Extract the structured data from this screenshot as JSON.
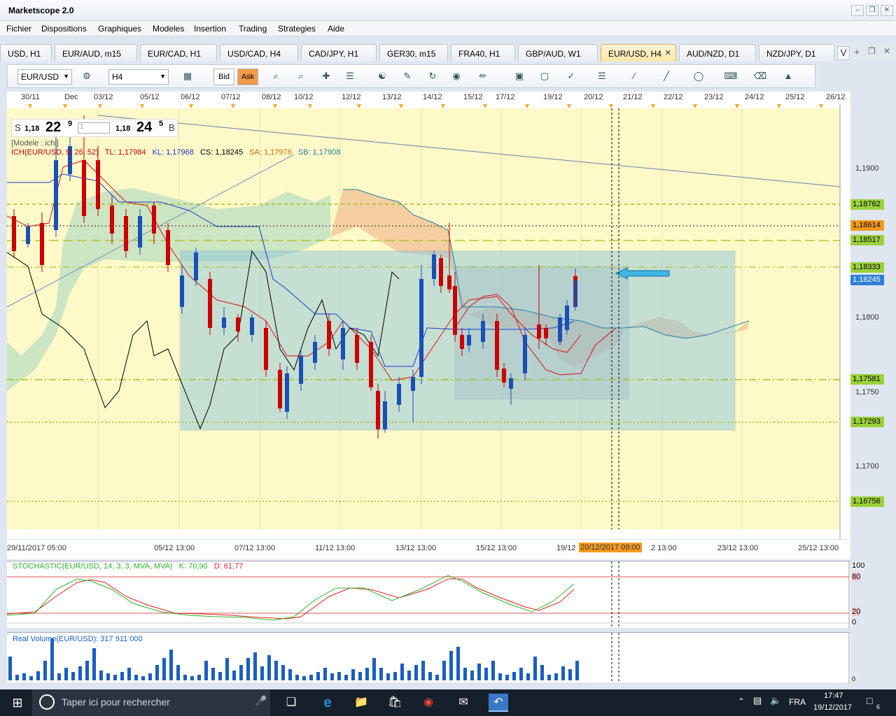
{
  "window": {
    "title": "Marketscope 2.0"
  },
  "menu": [
    "Fichier",
    "Dispositions",
    "Graphiques",
    "Modeles",
    "Insertion",
    "Trading",
    "Strategies",
    "Aide"
  ],
  "tabs": [
    {
      "label": "USD, H1",
      "active": false
    },
    {
      "label": "EUR/AUD, m15",
      "active": false
    },
    {
      "label": "EUR/CAD, H1",
      "active": false
    },
    {
      "label": "USD/CAD, H4",
      "active": false
    },
    {
      "label": "CAD/JPY, H1",
      "active": false
    },
    {
      "label": "GER30, m15",
      "active": false
    },
    {
      "label": "FRA40, H1",
      "active": false
    },
    {
      "label": "GBP/AUD, W1",
      "active": false
    },
    {
      "label": "EUR/USD, H4",
      "active": true
    },
    {
      "label": "AUD/NZD, D1",
      "active": false
    },
    {
      "label": "NZD/JPY, D1",
      "active": false
    }
  ],
  "toolbar": {
    "symbol": "EUR/USD",
    "timeframe": "H4",
    "bid_label": "Bid",
    "ask_label": "Ask"
  },
  "top_dates": [
    "30/11",
    "Dec",
    "03/12",
    "05/12",
    "06/12",
    "07/12",
    "08/12",
    "10/12",
    "12/12",
    "13/12",
    "14/12",
    "15/12",
    "17/12",
    "19/12",
    "20/12",
    "21/12",
    "22/12",
    "23/12",
    "24/12",
    "25/12",
    "26/12"
  ],
  "quote": {
    "sell_label": "S",
    "sell_big": "1,18",
    "sell_pips": "22",
    "sell_frac": "9",
    "qty": "1",
    "buy_big": "1,18",
    "buy_pips": "24",
    "buy_frac": "5",
    "buy_label": "B"
  },
  "chart": {
    "model_label": "[Modele : ichi]",
    "ichimoku_prefix": "ICH(EUR/USD, 9, 26, 52)",
    "tl": "TL: 1,17984",
    "kl": "KL: 1,17968",
    "cs": "CS: 1,18245",
    "sa": "SA: 1,17976",
    "sb": "SB: 1,17908",
    "axis_prices": [
      "1,1900",
      "1,1800",
      "1,1750",
      "1,1700"
    ],
    "price_tags": [
      {
        "value": "1,18762",
        "color": "#9bd13b"
      },
      {
        "value": "1,18614",
        "color": "#f39a1d"
      },
      {
        "value": "1,18517",
        "color": "#9bd13b"
      },
      {
        "value": "1,18333",
        "color": "#9bd13b"
      },
      {
        "value": "1,18245",
        "color": "#2f7fd6"
      },
      {
        "value": "1,17581",
        "color": "#9bd13b"
      },
      {
        "value": "1,17293",
        "color": "#9bd13b"
      },
      {
        "value": "1,16756",
        "color": "#9bd13b"
      }
    ]
  },
  "bottom_dates": [
    "29/11/2017 05:00",
    "05/12 13:00",
    "07/12 13:00",
    "11/12 13:00",
    "13/12 13:00",
    "15/12 13:00",
    "19/12",
    "20/12/2017 09:00",
    "2 13:00",
    "23/12 13:00",
    "25/12 13:00"
  ],
  "oscillator": {
    "label": "STOCHASTIC(EUR/USD, 14, 3, 3, MVA, MVA)",
    "k": "K: 70,90",
    "d": "D: 61,77",
    "levels": [
      "100",
      "80",
      "20",
      "0"
    ]
  },
  "volume": {
    "label": "Real Volume(EUR/USD): 317 911 000",
    "axis": "0"
  },
  "taskbar": {
    "search_placeholder": "Taper ici pour rechercher",
    "lang": "FRA",
    "time": "17:47",
    "date": "19/12/2017",
    "notif": "6"
  }
}
